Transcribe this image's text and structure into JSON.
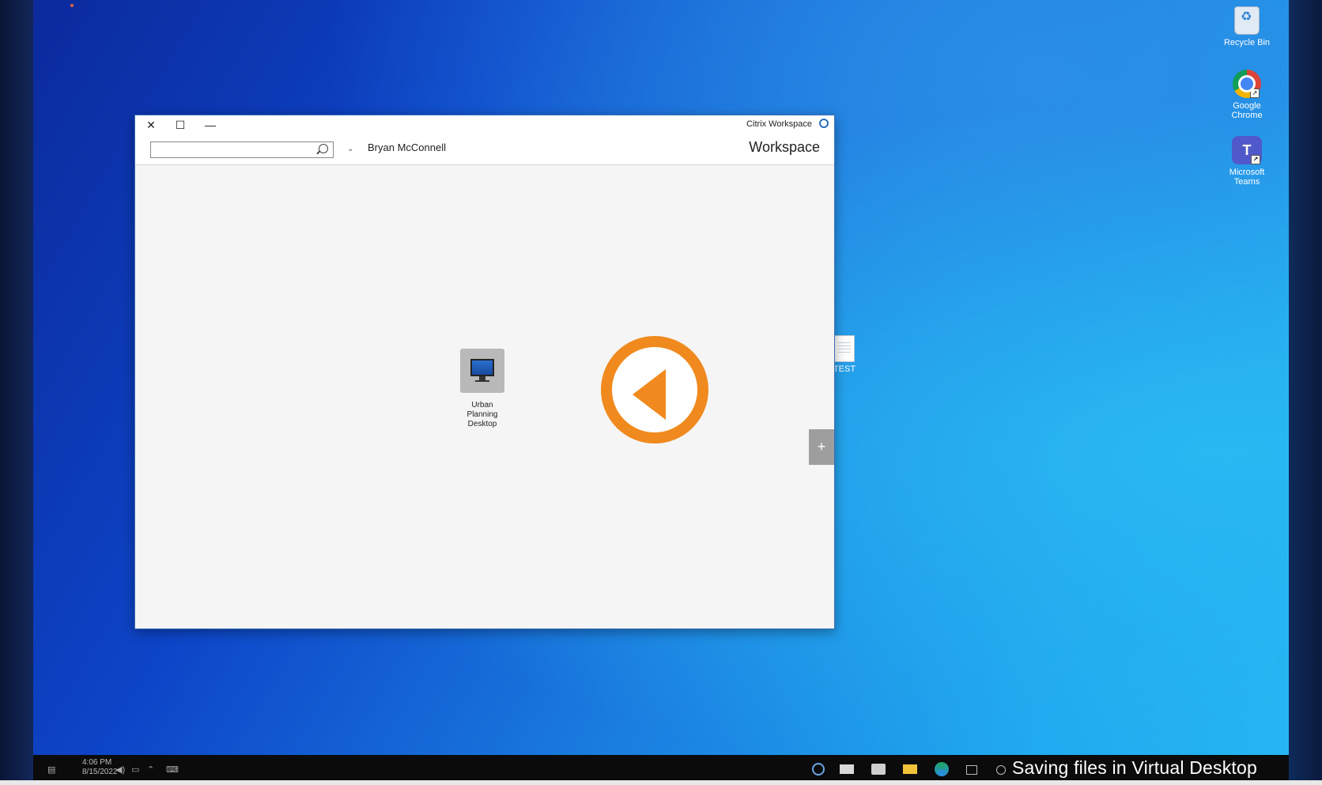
{
  "window": {
    "title": "Citrix Workspace",
    "brand": "Workspace",
    "close_glyph": "✕",
    "maximize_glyph": "☐",
    "minimize_glyph": "—"
  },
  "header": {
    "user_name": "Bryan McConnell",
    "user_chevron": "⌄",
    "search": {
      "value": "",
      "placeholder": ""
    }
  },
  "apps": [
    {
      "label_line1": "Urban Planning",
      "label_line2": "Desktop",
      "icon": "monitor-icon"
    }
  ],
  "add_button": "+",
  "desktop_icons": {
    "recycle_bin": "Recycle Bin",
    "chrome_line1": "Google",
    "chrome_line2": "Chrome",
    "teams_line1": "Microsoft",
    "teams_line2": "Teams",
    "teams_glyph": "T",
    "test_file": "TEST"
  },
  "taskbar": {
    "time": "4:06 PM",
    "date": "8/15/2022"
  },
  "caption": "Saving files in Virtual Desktop",
  "colors": {
    "accent_orange": "#f08a1e",
    "teams_purple": "#5059c9",
    "window_border": "#3d6fb8"
  }
}
